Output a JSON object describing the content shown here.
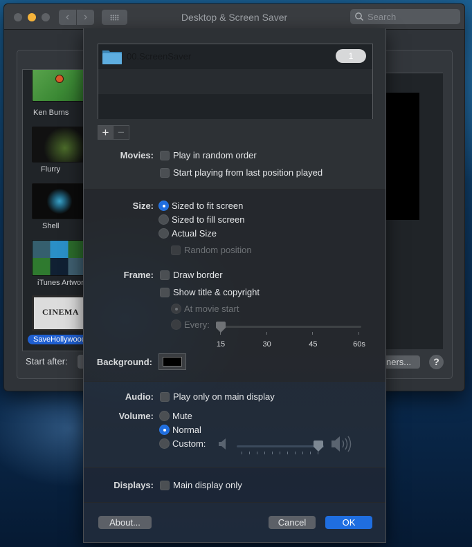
{
  "window": {
    "title": "Desktop & Screen Saver",
    "search_placeholder": "Search",
    "back_glyph": "‹",
    "forward_glyph": "›",
    "traffic_lights": {
      "close": "#5e6165",
      "minimize": "#f5b33a",
      "zoom": "#5e6165"
    }
  },
  "screen_savers": {
    "items": [
      {
        "label": "Ken Burns",
        "selected": false
      },
      {
        "label": "Flurry",
        "selected": false
      },
      {
        "label": "Shell",
        "selected": false
      },
      {
        "label": "iTunes Artwork",
        "selected": false
      },
      {
        "label": "SaveHollywood",
        "selected": true
      }
    ],
    "cinema_text": "CINEMA",
    "start_after_label": "Start after:",
    "savers_button_label": "ners...",
    "help_glyph": "?"
  },
  "sheet": {
    "folders": [
      {
        "name": "00.ScreenSaver",
        "count": "1"
      }
    ],
    "add_glyph": "+",
    "remove_glyph": "−",
    "movies": {
      "label": "Movies:",
      "options": [
        {
          "label": "Play in random order",
          "checked": false
        },
        {
          "label": "Start playing from last position played",
          "checked": false
        }
      ]
    },
    "size": {
      "label": "Size:",
      "options": [
        {
          "label": "Sized to fit screen",
          "selected": true
        },
        {
          "label": "Sized to fill screen",
          "selected": false
        },
        {
          "label": "Actual Size",
          "selected": false
        }
      ],
      "random_position": {
        "label": "Random position",
        "checked": false,
        "enabled": false
      }
    },
    "frame": {
      "label": "Frame:",
      "draw_border": {
        "label": "Draw border",
        "checked": false
      },
      "show_title": {
        "label": "Show title & copyright",
        "checked": false
      },
      "at_movie_start": {
        "label": "At movie start",
        "selected": true,
        "enabled": false
      },
      "every": {
        "label": "Every:",
        "selected": false,
        "enabled": false
      },
      "interval_slider": {
        "min": 15,
        "max": 60,
        "value": 15,
        "ticks": [
          "15",
          "30",
          "45",
          "60s"
        ]
      }
    },
    "background": {
      "label": "Background:",
      "color": "#000000"
    },
    "audio": {
      "label": "Audio:",
      "option": {
        "label": "Play only on main display",
        "checked": false
      }
    },
    "volume": {
      "label": "Volume:",
      "options": [
        {
          "label": "Mute",
          "selected": false
        },
        {
          "label": "Normal",
          "selected": true
        },
        {
          "label": "Custom:",
          "selected": false
        }
      ],
      "custom_slider": {
        "value_fraction": 1.0,
        "tick_count": 11
      }
    },
    "displays": {
      "label": "Displays:",
      "option": {
        "label": "Main display only",
        "checked": false
      }
    },
    "buttons": {
      "about": "About...",
      "cancel": "Cancel",
      "ok": "OK"
    },
    "accent_color": "#1f6ee0"
  }
}
